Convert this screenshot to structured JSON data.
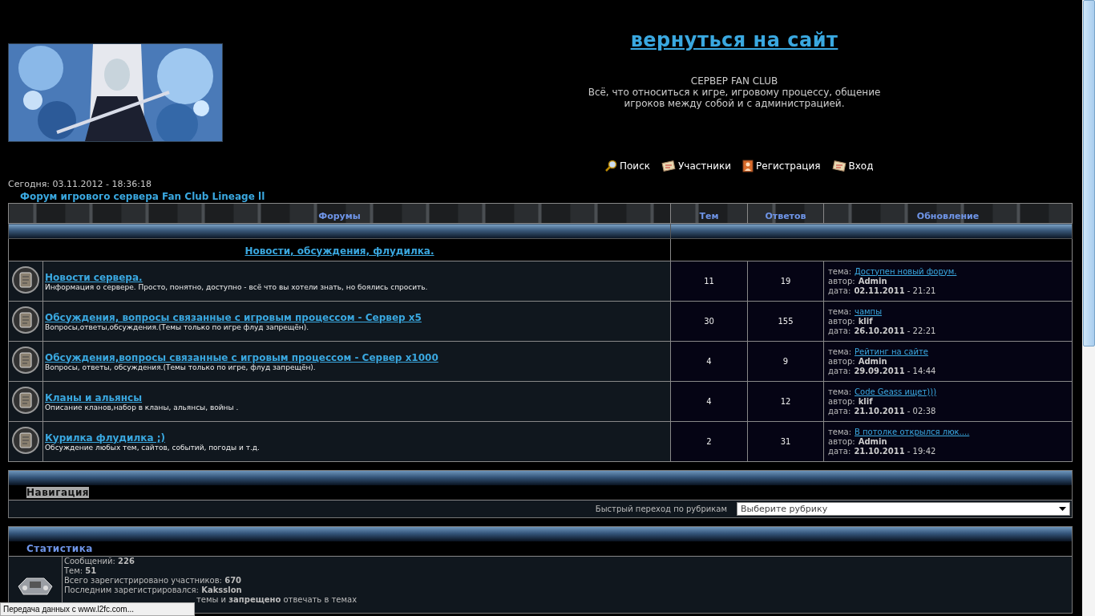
{
  "header": {
    "home_link": "вернуться на сайт",
    "subtitle": [
      "СЕРВЕР FAN CLUB",
      "Всё, что относиться к игре, игровому процессу, общение",
      "игроков между собой и с администрацией."
    ],
    "nav": [
      {
        "label": "Поиск",
        "kind": "search"
      },
      {
        "label": "Участники",
        "kind": "members"
      },
      {
        "label": "Регистрация",
        "kind": "register"
      },
      {
        "label": "Вход",
        "kind": "login"
      }
    ]
  },
  "date": "Сегодня: 03.11.2012 - 18:36:18",
  "forum_title": "Форум игрового сервера Fan Club Lineage ll",
  "table": {
    "columns": [
      "Форумы",
      "Тем",
      "Ответов",
      "Обновление"
    ],
    "category": "Новости, обсуждения, флудилка.",
    "rows": [
      {
        "title": "Новости сервера.",
        "description": "Информация о сервере. Просто, понятно, доступно - всё что вы хотели знать, но боялись спросить.",
        "topics": "11",
        "replies": "19",
        "topic_label": "тема:",
        "topic": "Доступен новый форум.",
        "author_label": "автор:",
        "author": "Admin",
        "date_label": "дата:",
        "date": "**02.11.2011** - 21:21"
      },
      {
        "title": "Обсуждения, вопросы связанные с игровым процессом - Сервер x5",
        "description": "Вопросы,ответы,обсуждения.(Темы только по игре флуд запрещён).",
        "topics": "30",
        "replies": "155",
        "topic_label": "тема:",
        "topic": "чампы",
        "author_label": "автор:",
        "author": "klif",
        "date_label": "дата:",
        "date": "**26.10.2011** - 22:21"
      },
      {
        "title": "Обсуждения,вопросы связанные с игровым процессом - Сервер x1000",
        "description": "Вопросы, ответы, обсуждения.(Темы только по игре, флуд запрещён).",
        "topics": "4",
        "replies": "9",
        "topic_label": "тема:",
        "topic": "Рейтинг на сайте",
        "author_label": "автор:",
        "author": "Admin",
        "date_label": "дата:",
        "date": "**29.09.2011** - 14:44"
      },
      {
        "title": "Кланы и альянсы",
        "description": "Описание кланов,набор в кланы, альянсы, войны .",
        "topics": "4",
        "replies": "12",
        "topic_label": "тема:",
        "topic": "Code Geass ищет)))",
        "author_label": "автор:",
        "author": "klif",
        "date_label": "дата:",
        "date": "**21.10.2011** - 02:38"
      },
      {
        "title": "Курилка флудилка ;)",
        "description": "Обсуждение любых тем, сайтов, событий, погоды и т.д.",
        "topics": "2",
        "replies": "31",
        "topic_label": "тема:",
        "topic": "В потолке открылся люк....",
        "author_label": "автор:",
        "author": "Admin",
        "date_label": "дата:",
        "date": "**21.10.2011** - 19:42"
      }
    ]
  },
  "navigation": {
    "title": "Навигация",
    "highlighted": true,
    "quick_jump_label": "Быстрый переход по рубрикам",
    "select_value": "Выберите рубрику"
  },
  "statistics": {
    "title": "Статистика",
    "lines": [
      "Сообщений: **226**",
      "Тем: **51**",
      "Всего зарегистрировано участников: **670**",
      "Последним зарегистрировался: **Kaksslon**",
      "темы и **запрещено** отвечать в темах"
    ]
  },
  "status_bar": "Передача данных с www.l2fc.com..."
}
